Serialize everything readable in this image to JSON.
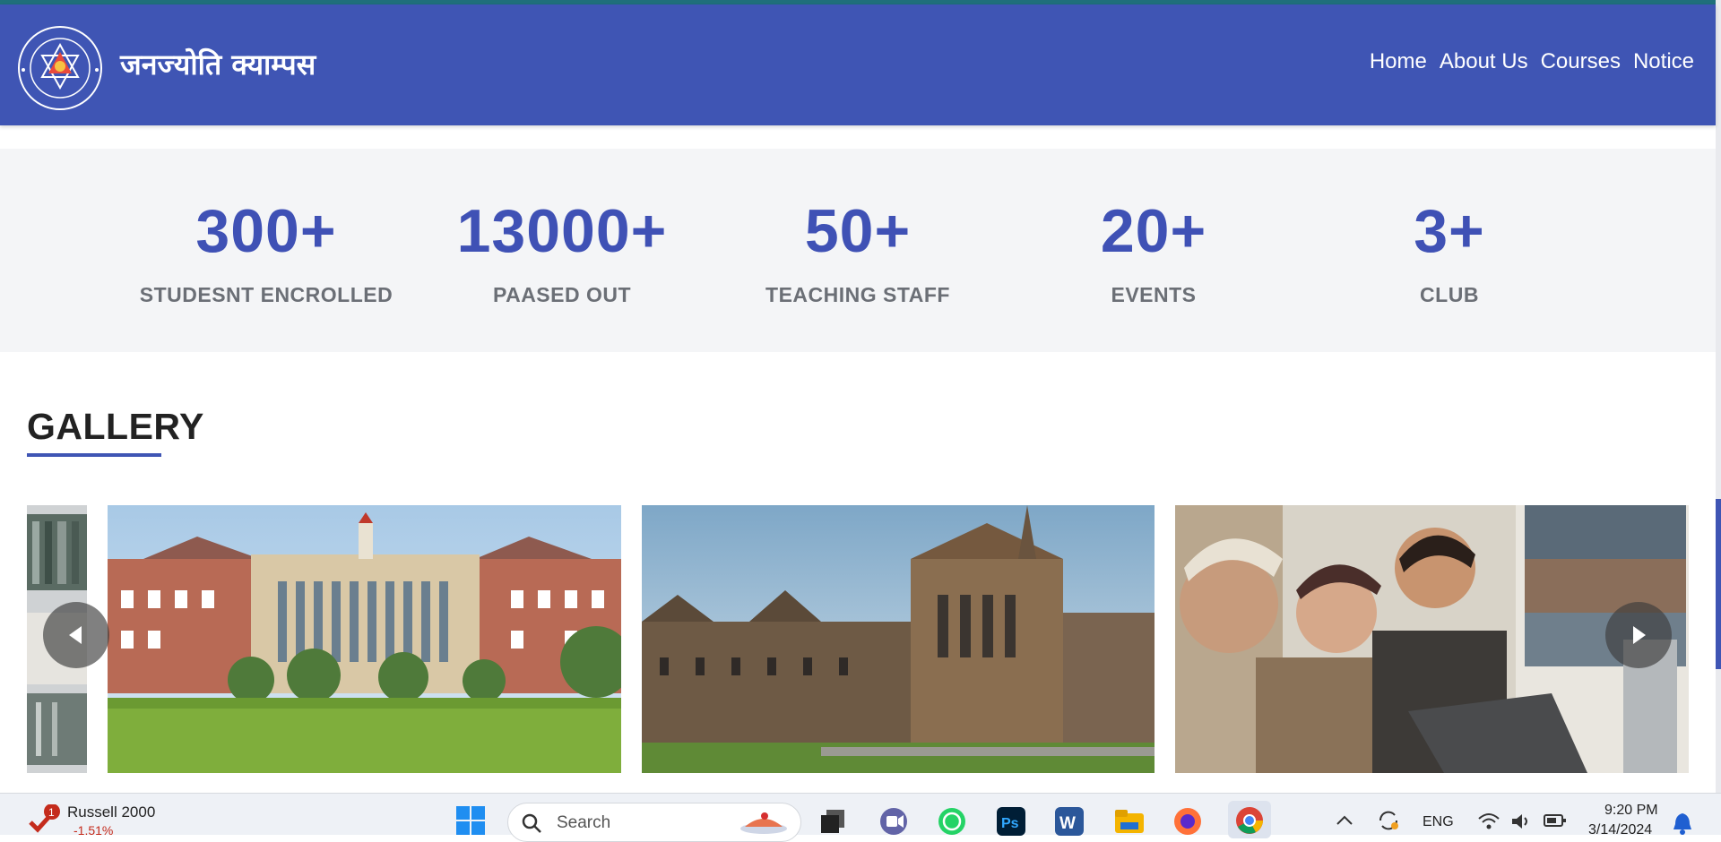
{
  "header": {
    "brand": "जनज्योति क्याम्पस",
    "logo_ring_text": "Janjyoti Campus",
    "logo_estd": "ESTD 2058",
    "logo_location": "Mahendranagar, Kanchanpur",
    "bg_color": "#3f55b4",
    "nav": [
      {
        "label": "Home"
      },
      {
        "label": "About Us"
      },
      {
        "label": "Courses"
      },
      {
        "label": "Notice"
      }
    ]
  },
  "stats": [
    {
      "value": "300+",
      "label": "STUDESNT ENCROLLED"
    },
    {
      "value": "13000+",
      "label": "PAASED OUT"
    },
    {
      "value": "50+",
      "label": "TEACHING STAFF"
    },
    {
      "value": "20+",
      "label": "EVENTS"
    },
    {
      "value": "3+",
      "label": "CLUB"
    }
  ],
  "gallery": {
    "title": "GALLERY",
    "images": [
      {
        "name": "library-shelves-partial"
      },
      {
        "name": "brick-campus-building"
      },
      {
        "name": "gothic-university-building"
      },
      {
        "name": "students-laughing-laptop"
      }
    ]
  },
  "taskbar": {
    "ticker_badge": "1",
    "ticker_name": "Russell 2000",
    "ticker_change": "-1.51%",
    "search_placeholder": "Search",
    "language": "ENG",
    "time": "9:20 PM",
    "date": "3/14/2024",
    "icons": [
      "windows-start-icon",
      "search-icon",
      "task-view-icon",
      "teams-icon",
      "whatsapp-icon",
      "photoshop-icon",
      "word-icon",
      "file-explorer-icon",
      "firefox-icon",
      "chrome-icon",
      "chevron-up-icon",
      "sync-icon",
      "wifi-icon",
      "volume-icon",
      "battery-icon",
      "notification-bell-icon"
    ]
  }
}
